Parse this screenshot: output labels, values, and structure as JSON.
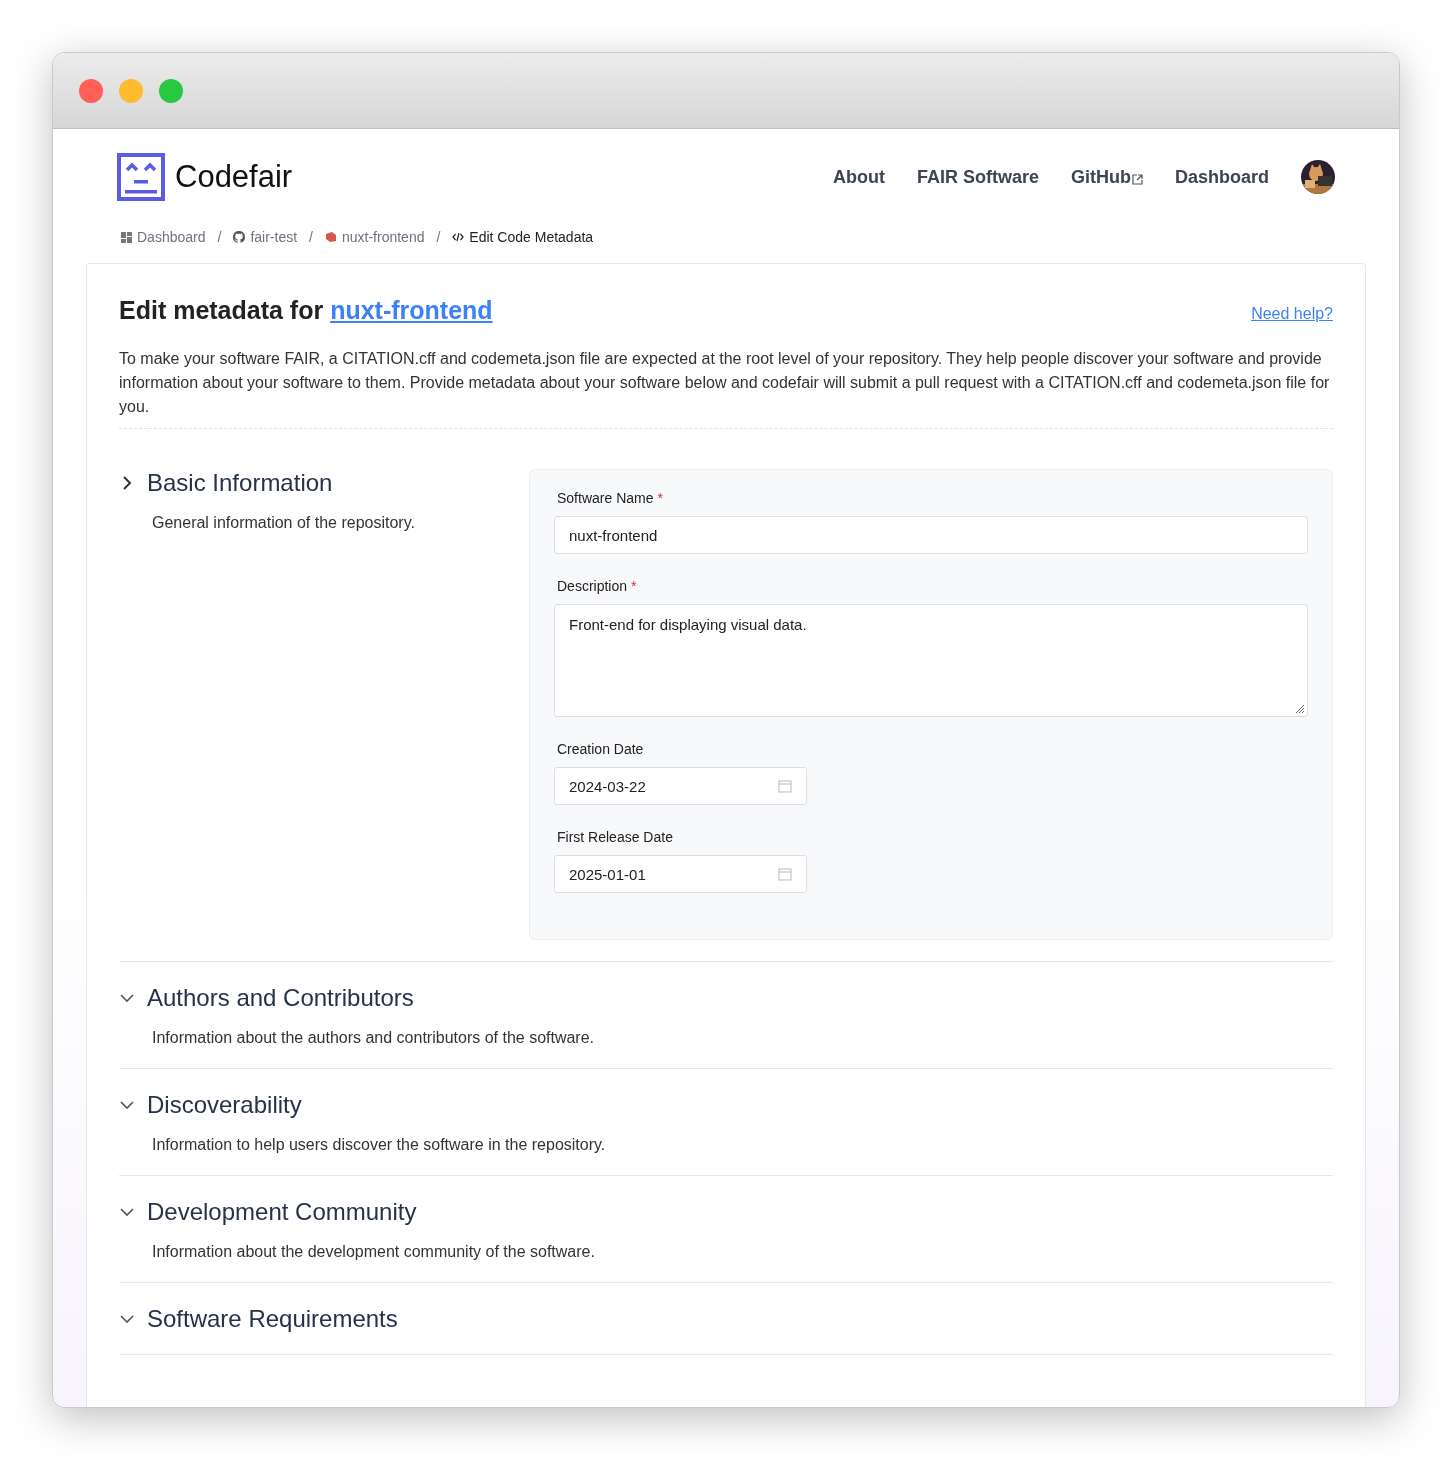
{
  "window": {
    "controls": [
      {
        "color": "#ff5f57"
      },
      {
        "color": "#febc2e"
      },
      {
        "color": "#28c840"
      }
    ]
  },
  "header": {
    "brand": "Codefair",
    "nav": [
      {
        "label": "About",
        "external": false
      },
      {
        "label": "FAIR Software",
        "external": false
      },
      {
        "label": "GitHub",
        "external": true
      },
      {
        "label": "Dashboard",
        "external": false
      }
    ]
  },
  "breadcrumb": [
    {
      "label": "Dashboard",
      "kind": "dashboard",
      "current": false
    },
    {
      "label": "fair-test",
      "kind": "github",
      "current": false
    },
    {
      "label": "nuxt-frontend",
      "kind": "repo",
      "current": false
    },
    {
      "label": "Edit Code Metadata",
      "kind": "code",
      "current": true
    }
  ],
  "breadcrumb_separator": "/",
  "page": {
    "title_prefix": "Edit metadata for",
    "title_link": "nuxt-frontend",
    "help_link": "Need help?",
    "intro": "To make your software FAIR, a CITATION.cff and codemeta.json file are expected at the root level of your repository. They help people discover your software and provide information about your software to them. Provide metadata about your software below and codefair will submit a pull request with a CITATION.cff and codemeta.json file for you."
  },
  "sections": [
    {
      "title": "Basic Information",
      "description": "General information of the repository.",
      "expanded": true,
      "fields": [
        {
          "kind": "text",
          "label": "Software Name",
          "required": true,
          "value": "nuxt-frontend"
        },
        {
          "kind": "textarea",
          "label": "Description",
          "required": true,
          "value": "Front-end for displaying visual data."
        },
        {
          "kind": "date",
          "label": "Creation Date",
          "required": false,
          "value": "2024-03-22"
        },
        {
          "kind": "date",
          "label": "First Release Date",
          "required": false,
          "value": "2025-01-01"
        }
      ]
    },
    {
      "title": "Authors and Contributors",
      "description": "Information about the authors and contributors of the software.",
      "expanded": false
    },
    {
      "title": "Discoverability",
      "description": "Information to help users discover the software in the repository.",
      "expanded": false
    },
    {
      "title": "Development Community",
      "description": "Information about the development community of the software.",
      "expanded": false
    },
    {
      "title": "Software Requirements",
      "expanded": false
    }
  ],
  "required_mark": "*"
}
